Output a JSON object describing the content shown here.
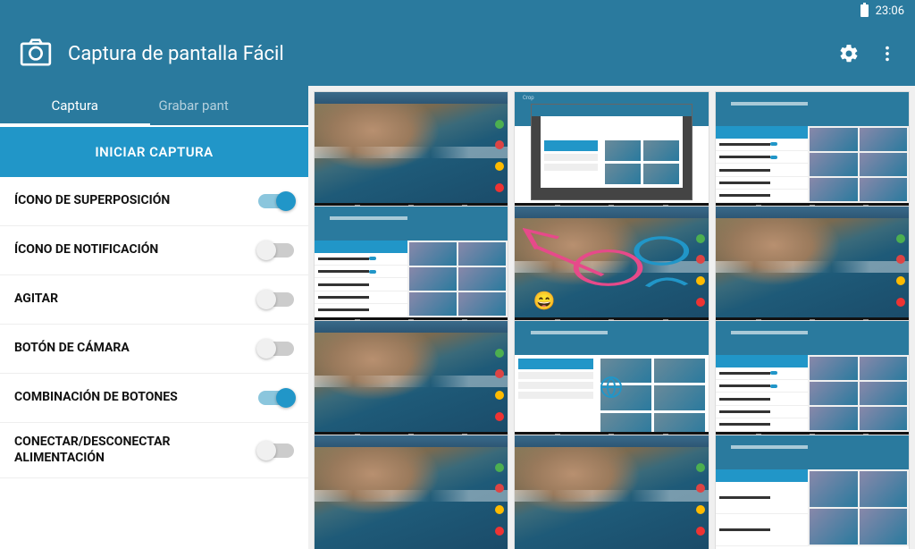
{
  "status": {
    "time": "23:06"
  },
  "app": {
    "title": "Captura de pantalla Fácil"
  },
  "tabs": {
    "active": "Captura",
    "secondary": "Grabar pant"
  },
  "actions": {
    "primary_button": "INICIAR CAPTURA"
  },
  "settings": [
    {
      "label": "ÍCONO DE SUPERPOSICIÓN",
      "on": true
    },
    {
      "label": "ÍCONO DE NOTIFICACIÓN",
      "on": false
    },
    {
      "label": "AGITAR",
      "on": false
    },
    {
      "label": "BOTÓN DE CÁMARA",
      "on": false
    },
    {
      "label": "COMBINACIÓN DE BOTONES",
      "on": true
    },
    {
      "label": "CONECTAR/DESCONECTAR ALIMENTACIÓN",
      "on": false
    }
  ],
  "gallery": {
    "items": [
      {
        "kind": "coast-sidebar"
      },
      {
        "kind": "crop-dialog"
      },
      {
        "kind": "settings-grid"
      },
      {
        "kind": "settings-grid"
      },
      {
        "kind": "coast-drawing"
      },
      {
        "kind": "coast-sidebar"
      },
      {
        "kind": "coast-sidebar"
      },
      {
        "kind": "globe-grid"
      },
      {
        "kind": "settings-grid"
      },
      {
        "kind": "coast-sidebar"
      },
      {
        "kind": "coast-sidebar"
      },
      {
        "kind": "settings-grid"
      }
    ]
  }
}
